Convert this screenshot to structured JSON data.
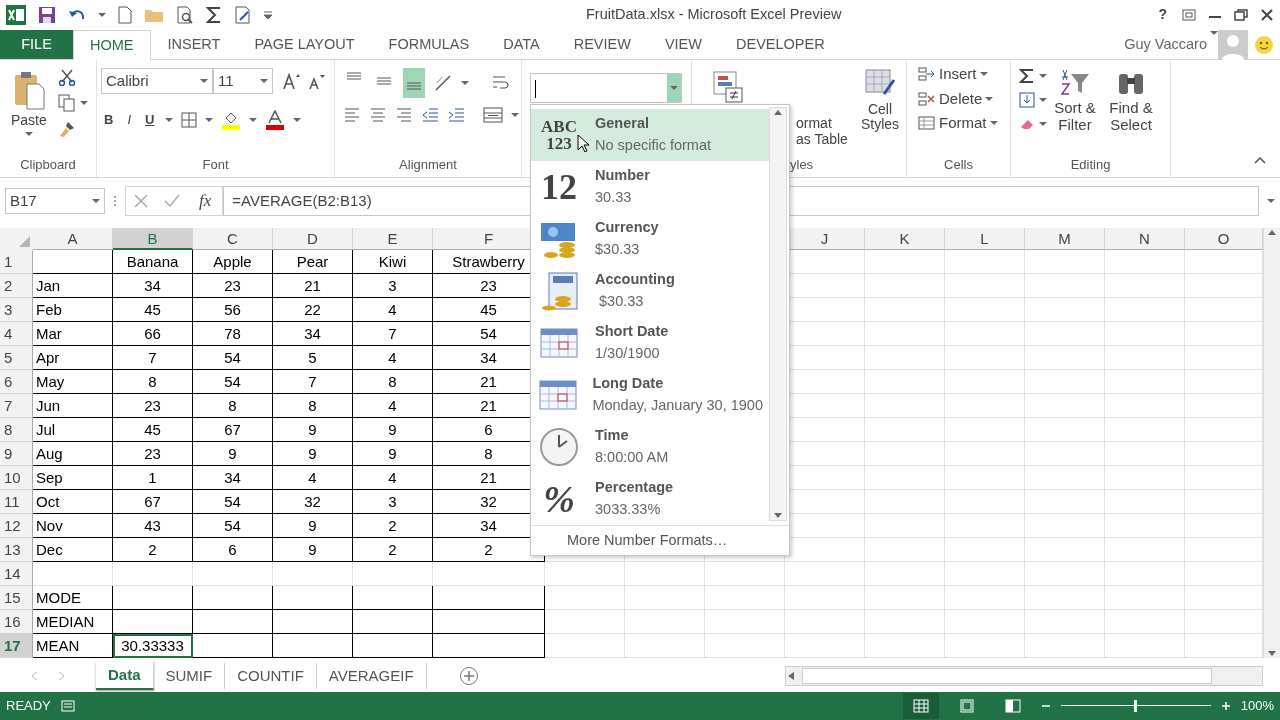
{
  "title_bar": {
    "title": "FruitData.xlsx - Microsoft Excel Preview",
    "help": "?"
  },
  "tabs": [
    {
      "label": "FILE",
      "kind": "file",
      "selected": false
    },
    {
      "label": "HOME",
      "kind": "tab",
      "selected": true
    },
    {
      "label": "INSERT",
      "kind": "tab",
      "selected": false
    },
    {
      "label": "PAGE LAYOUT",
      "kind": "tab",
      "selected": false
    },
    {
      "label": "FORMULAS",
      "kind": "tab",
      "selected": false
    },
    {
      "label": "DATA",
      "kind": "tab",
      "selected": false
    },
    {
      "label": "REVIEW",
      "kind": "tab",
      "selected": false
    },
    {
      "label": "VIEW",
      "kind": "tab",
      "selected": false
    },
    {
      "label": "DEVELOPER",
      "kind": "tab",
      "selected": false
    }
  ],
  "user": {
    "name": "Guy Vaccaro"
  },
  "ribbon": {
    "clipboard": {
      "paste": "Paste",
      "label": "Clipboard"
    },
    "font": {
      "name": "Calibri",
      "size": "11",
      "bold": "B",
      "italic": "I",
      "underline": "U",
      "label": "Font"
    },
    "alignment": {
      "label": "Alignment",
      "vertical_align": [
        {
          "kind": "top",
          "selected": false
        },
        {
          "kind": "middle",
          "selected": false
        },
        {
          "kind": "bottom",
          "selected": true
        }
      ]
    },
    "styles": {
      "format_as_table": "ormat as Table",
      "cell_styles": "Cell Styles",
      "label": "yles"
    },
    "cells": {
      "buttons": [
        {
          "label": "Insert",
          "kind": "insert"
        },
        {
          "label": "Delete",
          "kind": "delete"
        },
        {
          "label": "Format",
          "kind": "format"
        }
      ],
      "label": "Cells"
    },
    "editing": {
      "sort": "Sort & Filter",
      "find": "Find & Select",
      "label": "Editing"
    }
  },
  "formula_bar": {
    "name_box": "B17",
    "fx": "fx",
    "formula": "=AVERAGE(B2:B13)"
  },
  "sheet": {
    "columns": [
      {
        "label": "A",
        "selected": false
      },
      {
        "label": "B",
        "selected": true
      },
      {
        "label": "C",
        "selected": false
      },
      {
        "label": "D",
        "selected": false
      },
      {
        "label": "E",
        "selected": false
      },
      {
        "label": "F",
        "selected": false
      },
      {
        "label": "J",
        "selected": false
      },
      {
        "label": "K",
        "selected": false
      },
      {
        "label": "L",
        "selected": false
      },
      {
        "label": "M",
        "selected": false
      },
      {
        "label": "N",
        "selected": false
      },
      {
        "label": "O",
        "selected": false
      }
    ],
    "rows": [
      {
        "number": "1",
        "selected": false,
        "cells": [
          null,
          "Banana",
          "Apple",
          "Pear",
          "Kiwi",
          "Strawberry"
        ]
      },
      {
        "number": "2",
        "selected": false,
        "cells": [
          "Jan",
          "34",
          "23",
          "21",
          "3",
          "23"
        ]
      },
      {
        "number": "3",
        "selected": false,
        "cells": [
          "Feb",
          "45",
          "56",
          "22",
          "4",
          "45"
        ]
      },
      {
        "number": "4",
        "selected": false,
        "cells": [
          "Mar",
          "66",
          "78",
          "34",
          "7",
          "54"
        ]
      },
      {
        "number": "5",
        "selected": false,
        "cells": [
          "Apr",
          "7",
          "54",
          "5",
          "4",
          "34"
        ]
      },
      {
        "number": "6",
        "selected": false,
        "cells": [
          "May",
          "8",
          "54",
          "7",
          "8",
          "21"
        ]
      },
      {
        "number": "7",
        "selected": false,
        "cells": [
          "Jun",
          "23",
          "8",
          "8",
          "4",
          "21"
        ]
      },
      {
        "number": "8",
        "selected": false,
        "cells": [
          "Jul",
          "45",
          "67",
          "9",
          "9",
          "6"
        ]
      },
      {
        "number": "9",
        "selected": false,
        "cells": [
          "Aug",
          "23",
          "9",
          "9",
          "9",
          "8"
        ]
      },
      {
        "number": "10",
        "selected": false,
        "cells": [
          "Sep",
          "1",
          "34",
          "4",
          "4",
          "21"
        ]
      },
      {
        "number": "11",
        "selected": false,
        "cells": [
          "Oct",
          "67",
          "54",
          "32",
          "3",
          "32"
        ]
      },
      {
        "number": "12",
        "selected": false,
        "cells": [
          "Nov",
          "43",
          "54",
          "9",
          "2",
          "34"
        ]
      },
      {
        "number": "13",
        "selected": false,
        "cells": [
          "Dec",
          "2",
          "6",
          "9",
          "2",
          "2"
        ]
      },
      {
        "number": "14",
        "selected": false,
        "cells": [
          null,
          null,
          null,
          null,
          null,
          null
        ]
      },
      {
        "number": "15",
        "selected": false,
        "cells": [
          "MODE",
          null,
          null,
          null,
          null,
          null
        ]
      },
      {
        "number": "16",
        "selected": false,
        "cells": [
          "MEDIAN",
          null,
          null,
          null,
          null,
          null
        ]
      },
      {
        "number": "17",
        "selected": true,
        "cells": [
          "MEAN",
          "30.33333",
          null,
          null,
          null,
          null
        ]
      }
    ]
  },
  "number_format_menu": {
    "items": [
      {
        "kind": "general",
        "icon_text": [
          "ABC",
          "123"
        ],
        "title": "General",
        "sample": "No specific format",
        "selected": true
      },
      {
        "kind": "number",
        "icon_text": [
          "12"
        ],
        "title": "Number",
        "sample": "30.33",
        "selected": false
      },
      {
        "kind": "currency",
        "title": "Currency",
        "sample": "$30.33",
        "selected": false
      },
      {
        "kind": "accounting",
        "title": "Accounting",
        "sample": " $30.33",
        "selected": false
      },
      {
        "kind": "short_date",
        "title": "Short Date",
        "sample": "1/30/1900",
        "selected": false
      },
      {
        "kind": "long_date",
        "title": "Long Date",
        "sample": "Monday, January 30, 1900",
        "selected": false
      },
      {
        "kind": "time",
        "title": "Time",
        "sample": "8:00:00 AM",
        "selected": false
      },
      {
        "kind": "percentage",
        "icon_text": [
          "%"
        ],
        "title": "Percentage",
        "sample": "3033.33%",
        "selected": false
      }
    ],
    "more": "More Number Formats…"
  },
  "sheet_tabs": [
    {
      "label": "Data",
      "selected": true
    },
    {
      "label": "SUMIF",
      "selected": false
    },
    {
      "label": "COUNTIF",
      "selected": false
    },
    {
      "label": "AVERAGEIF",
      "selected": false
    }
  ],
  "status_bar": {
    "mode": "READY",
    "zoom": "100%",
    "views": [
      {
        "kind": "normal",
        "selected": true
      },
      {
        "kind": "page_layout",
        "selected": false
      },
      {
        "kind": "page_break",
        "selected": false
      }
    ],
    "zoom_slider": {
      "level": 0.5
    }
  }
}
